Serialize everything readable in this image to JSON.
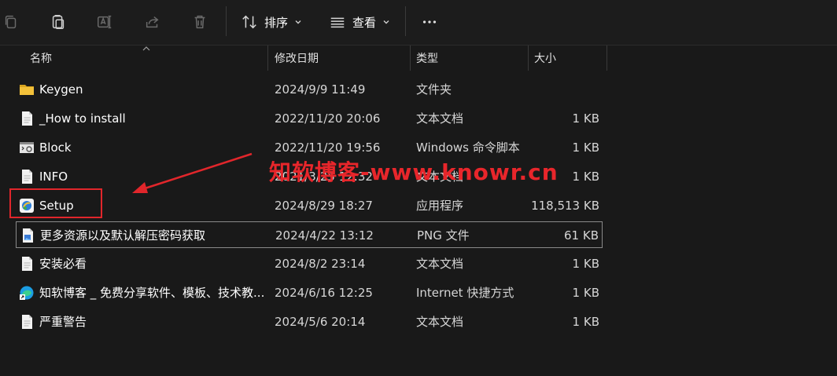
{
  "toolbar": {
    "sort_label": "排序",
    "view_label": "查看"
  },
  "columns": {
    "name": "名称",
    "modified": "修改日期",
    "type": "类型",
    "size": "大小"
  },
  "files": [
    {
      "name": "Keygen",
      "date": "2024/9/9 11:49",
      "type": "文件夹",
      "size": "",
      "icon": "folder-icon"
    },
    {
      "name": "_How to install",
      "date": "2022/11/20 20:06",
      "type": "文本文档",
      "size": "1 KB",
      "icon": "text-file-icon"
    },
    {
      "name": "Block",
      "date": "2022/11/20 19:56",
      "type": "Windows 命令脚本",
      "size": "1 KB",
      "icon": "script-icon"
    },
    {
      "name": "INFO",
      "date": "2021/3/25 12:32",
      "type": "文本文档",
      "size": "1 KB",
      "icon": "text-file-icon"
    },
    {
      "name": "Setup",
      "date": "2024/8/29 18:27",
      "type": "应用程序",
      "size": "118,513 KB",
      "icon": "installer-icon"
    },
    {
      "name": "更多资源以及默认解压密码获取",
      "date": "2024/4/22 13:12",
      "type": "PNG 文件",
      "size": "61 KB",
      "icon": "image-file-icon"
    },
    {
      "name": "安装必看",
      "date": "2024/8/2 23:14",
      "type": "文本文档",
      "size": "1 KB",
      "icon": "text-file-icon"
    },
    {
      "name": "知软博客 _ 免费分享软件、模板、技术教...",
      "date": "2024/6/16 12:25",
      "type": "Internet 快捷方式",
      "size": "1 KB",
      "icon": "web-shortcut-icon"
    },
    {
      "name": "严重警告",
      "date": "2024/5/6 20:14",
      "type": "文本文档",
      "size": "1 KB",
      "icon": "text-file-icon"
    }
  ],
  "watermark": "知软博客-www.knowr.cn",
  "colors": {
    "annotation_red": "#e1262b",
    "background": "#191919",
    "folder_yellow": "#f3c13a"
  }
}
